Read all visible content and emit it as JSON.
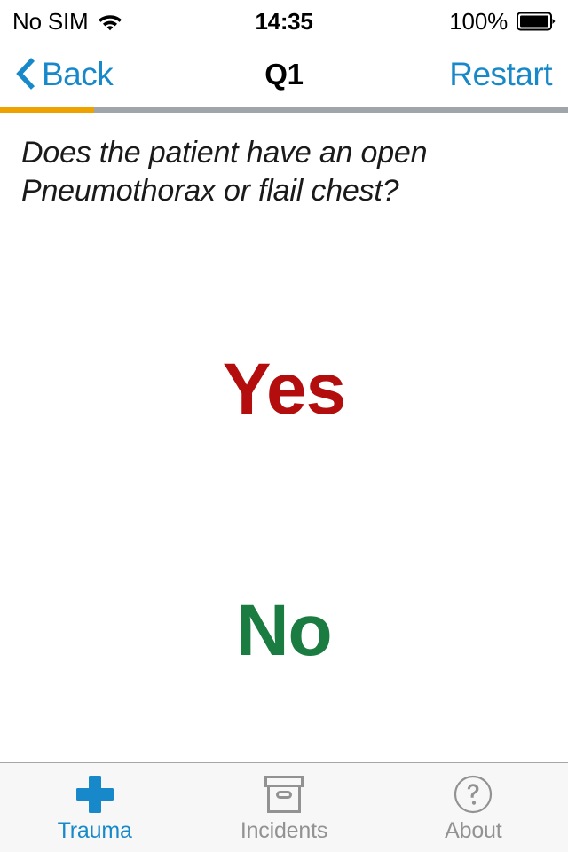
{
  "status_bar": {
    "carrier": "No SIM",
    "wifi_icon": "wifi-icon",
    "time": "14:35",
    "battery_percent": "100%",
    "battery_icon": "battery-full-icon"
  },
  "nav_bar": {
    "back_icon": "chevron-left-icon",
    "back_label": "Back",
    "title": "Q1",
    "restart_label": "Restart"
  },
  "progress": {
    "percent": 16.6,
    "fill_color": "#eda200",
    "track_color": "#a0a5ab"
  },
  "question": {
    "text": "Does the patient have an open Pneumothorax or flail chest?"
  },
  "answers": {
    "yes_label": "Yes",
    "yes_color": "#b30d0d",
    "no_label": "No",
    "no_color": "#1b7c42"
  },
  "tab_bar": {
    "items": [
      {
        "label": "Trauma",
        "icon": "plus-icon",
        "active": true
      },
      {
        "label": "Incidents",
        "icon": "archive-box-icon",
        "active": false
      },
      {
        "label": "About",
        "icon": "question-circle-icon",
        "active": false
      }
    ],
    "active_color": "#1789ca",
    "inactive_color": "#929292"
  }
}
